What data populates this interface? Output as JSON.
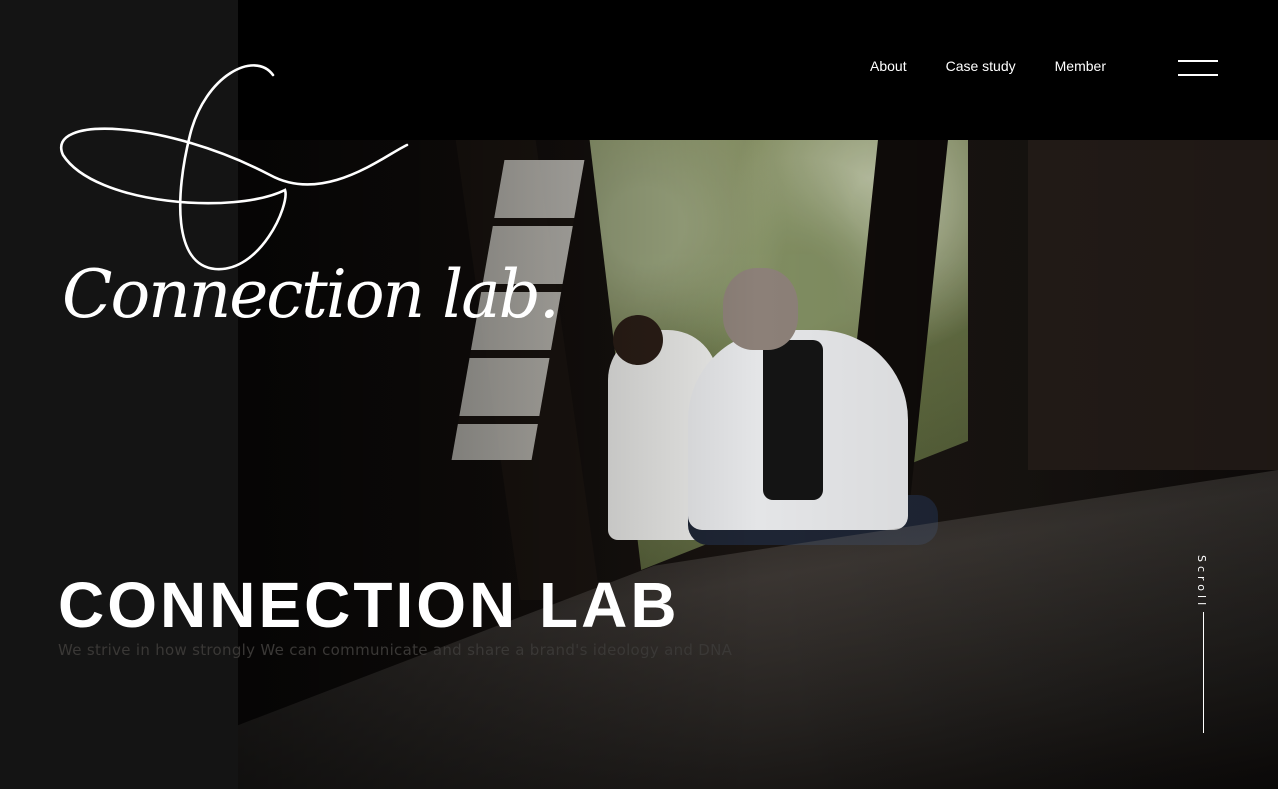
{
  "brand": {
    "logo_text": "Connection lab.",
    "logo_mark": "script-C-infinity-logo"
  },
  "nav": {
    "items": [
      {
        "label": "About"
      },
      {
        "label": "Case study"
      },
      {
        "label": "Member"
      }
    ],
    "menu_icon": "hamburger-icon"
  },
  "hero": {
    "title": "CONNECTION LAB",
    "tagline": "We strive in how strongly We can communicate and share a brand's ideology and DNA",
    "image": "two-people-sitting-on-veranda-photo"
  },
  "scroll": {
    "label": "Scroll"
  }
}
